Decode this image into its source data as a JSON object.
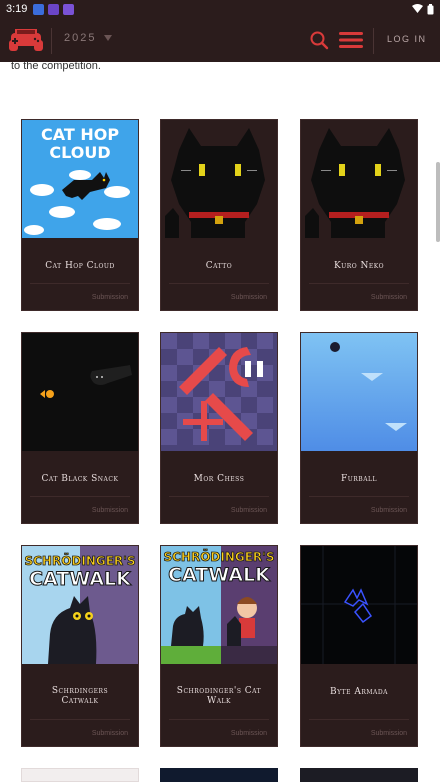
{
  "status_bar": {
    "time": "3:19",
    "icon_colors": [
      "#3b6ddb",
      "#6b45c7",
      "#7a52d6"
    ]
  },
  "header": {
    "year": "2025",
    "login_label": "LOG IN",
    "accent_color": "#d93a3a"
  },
  "intro_text": "to the competition.",
  "cards": [
    {
      "title": "Cat Hop Cloud",
      "badge": "Submission",
      "icon": "cat-hop-cloud-thumbnail"
    },
    {
      "title": "Catto",
      "badge": "Submission",
      "icon": "black-cat-thumbnail"
    },
    {
      "title": "Kuro Neko",
      "badge": "Submission",
      "icon": "black-cat-thumbnail"
    },
    {
      "title": "Cat Black Snack",
      "badge": "Submission",
      "icon": "black-snack-thumbnail"
    },
    {
      "title": "Mor Chess",
      "badge": "Submission",
      "icon": "chess-thumbnail"
    },
    {
      "title": "Furball",
      "badge": "Submission",
      "icon": "furball-thumbnail"
    },
    {
      "title": "Schrdingers Catwalk",
      "badge": "Submission",
      "icon": "catwalk-thumbnail",
      "art_text": [
        "SCHRÖDINGER'S",
        "CATWALK"
      ]
    },
    {
      "title": "Schrodinger's Cat Walk",
      "badge": "Submission",
      "icon": "catwalk-thumbnail",
      "art_text": [
        "SCHRÖDINGER'S",
        "CATWALK"
      ]
    },
    {
      "title": "Byte Armada",
      "badge": "Submission",
      "icon": "space-thumbnail"
    }
  ],
  "cat_hop_art": [
    "CAT HOP",
    "CLOUD"
  ]
}
